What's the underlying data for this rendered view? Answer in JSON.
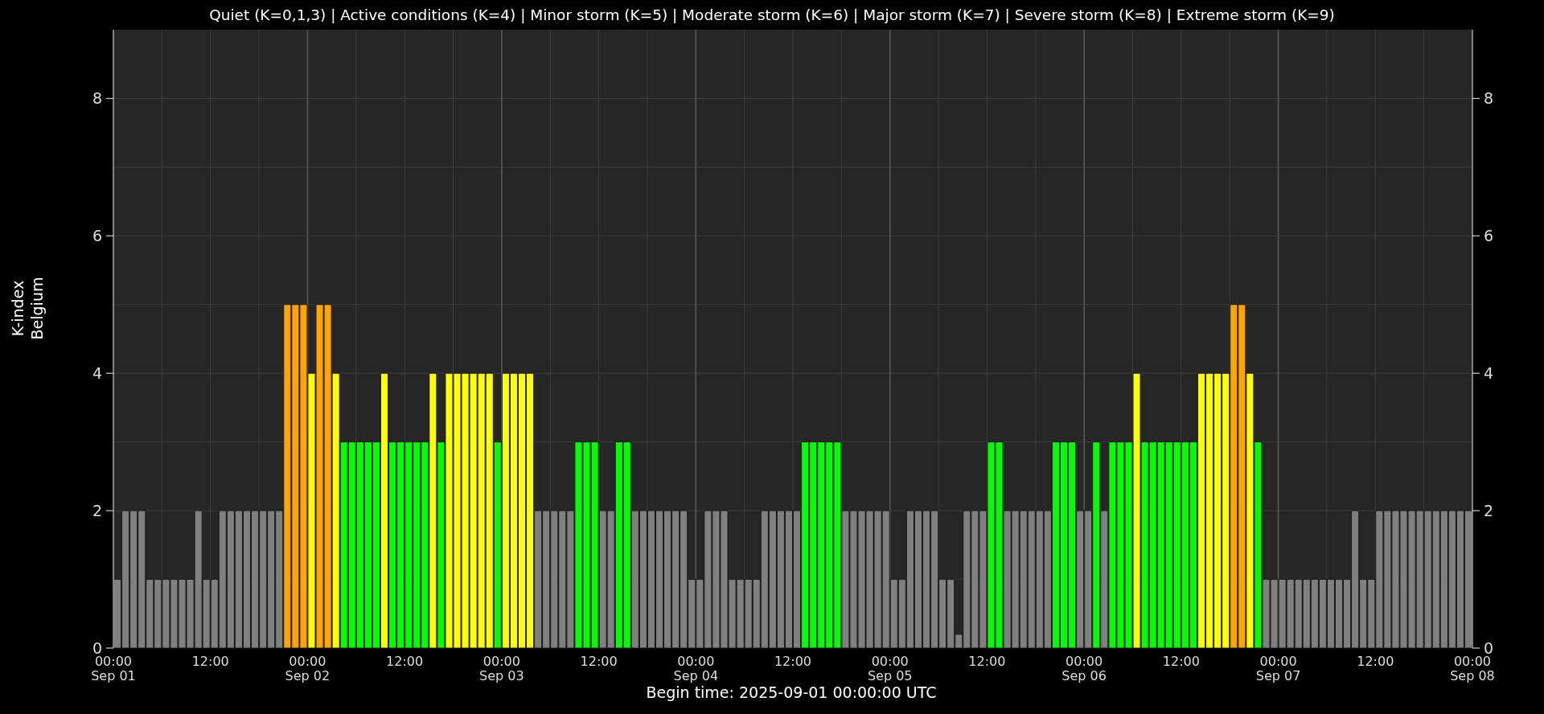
{
  "title": "Quiet (K=0,1,3) | Active conditions (K=4) | Minor storm (K=5) | Moderate storm (K=6) | Major storm (K=7) | Severe storm (K=8) | Extreme storm (K=9)",
  "k_levels": [
    {
      "color": "#808080"
    },
    {
      "color": "#808080"
    },
    {
      "color": "#808080"
    },
    {
      "color": "#00ff00"
    },
    {
      "color": "#ffff00"
    },
    {
      "color": "#ffa500"
    }
  ],
  "right_yticks": [
    "8",
    "6",
    "4",
    "2",
    "0"
  ],
  "x_axis_end_label": "00:00\nSep 08",
  "chart_data": {
    "type": "bar",
    "grid": true,
    "xlabel": "Begin time: 2025-09-01 00:00:00 UTC",
    "ylabel": "K-index\nBelgium",
    "ylim": [
      0,
      9
    ],
    "yticks": [
      0,
      2,
      4,
      6,
      8
    ],
    "categories": [
      "00:00\nSep 01",
      null,
      null,
      null,
      null,
      null,
      null,
      null,
      null,
      null,
      null,
      null,
      "12:00",
      null,
      null,
      null,
      null,
      null,
      null,
      null,
      null,
      null,
      null,
      null,
      "00:00\nSep 02",
      null,
      null,
      null,
      null,
      null,
      null,
      null,
      null,
      null,
      null,
      null,
      "12:00",
      null,
      null,
      null,
      null,
      null,
      null,
      null,
      null,
      null,
      null,
      null,
      "00:00\nSep 03",
      null,
      null,
      null,
      null,
      null,
      null,
      null,
      null,
      null,
      null,
      null,
      "12:00",
      null,
      null,
      null,
      null,
      null,
      null,
      null,
      null,
      null,
      null,
      null,
      "00:00\nSep 04",
      null,
      null,
      null,
      null,
      null,
      null,
      null,
      null,
      null,
      null,
      null,
      "12:00",
      null,
      null,
      null,
      null,
      null,
      null,
      null,
      null,
      null,
      null,
      null,
      "00:00\nSep 05",
      null,
      null,
      null,
      null,
      null,
      null,
      null,
      null,
      null,
      null,
      null,
      "12:00",
      null,
      null,
      null,
      null,
      null,
      null,
      null,
      null,
      null,
      null,
      null,
      "00:00\nSep 06",
      null,
      null,
      null,
      null,
      null,
      null,
      null,
      null,
      null,
      null,
      null,
      "12:00",
      null,
      null,
      null,
      null,
      null,
      null,
      null,
      null,
      null,
      null,
      null,
      "00:00\nSep 07",
      null,
      null,
      null,
      null,
      null,
      null,
      null,
      null,
      null,
      null,
      null,
      "12:00",
      null,
      null,
      null,
      null,
      null,
      null,
      null,
      null,
      null,
      null,
      null
    ],
    "series": [
      {
        "values": [
          1,
          2,
          2,
          2,
          1,
          1,
          1,
          1,
          1,
          1,
          2,
          1,
          1,
          2,
          2,
          2,
          2,
          2,
          2,
          2,
          2,
          5,
          5,
          5,
          4,
          5,
          5,
          4,
          3,
          3,
          3,
          3,
          3,
          4,
          3,
          3,
          3,
          3,
          3,
          4,
          3,
          4,
          4,
          4,
          4,
          4,
          4,
          3,
          4,
          4,
          4,
          4,
          2,
          2,
          2,
          2,
          2,
          3,
          3,
          3,
          2,
          2,
          3,
          3,
          2,
          2,
          2,
          2,
          2,
          2,
          2,
          1,
          1,
          2,
          2,
          2,
          1,
          1,
          1,
          1,
          2,
          2,
          2,
          2,
          2,
          3,
          3,
          3,
          3,
          3,
          2,
          2,
          2,
          2,
          2,
          2,
          1,
          1,
          2,
          2,
          2,
          2,
          1,
          1,
          0.2,
          2,
          2,
          2,
          3,
          3,
          2,
          2,
          2,
          2,
          2,
          2,
          3,
          3,
          3,
          2,
          2,
          3,
          2,
          3,
          3,
          3,
          4,
          3,
          3,
          3,
          3,
          3,
          3,
          3,
          4,
          4,
          4,
          4,
          5,
          5,
          4,
          3,
          1,
          1,
          1,
          1,
          1,
          1,
          1,
          1,
          1,
          1,
          1,
          2,
          1,
          1,
          2,
          2,
          2,
          2,
          2,
          2,
          2,
          2,
          2,
          2,
          2,
          2
        ]
      }
    ]
  }
}
